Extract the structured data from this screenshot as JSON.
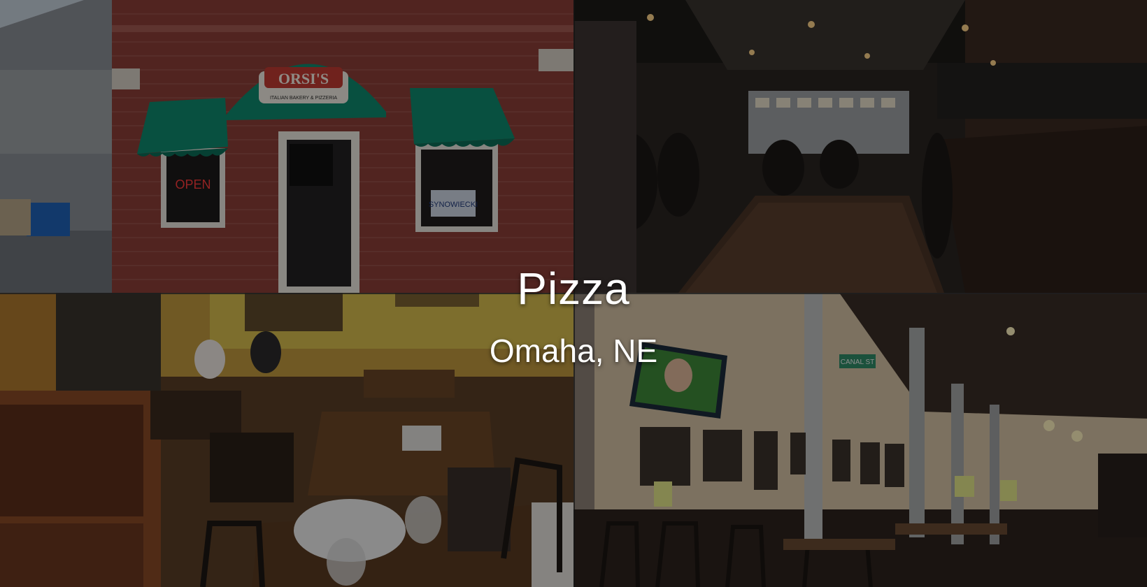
{
  "hero": {
    "title": "Pizza",
    "subtitle": "Omaha, NE"
  },
  "photos": [
    {
      "name": "storefront",
      "sign_text": "ORSI'S",
      "sign_subtext": "ITALIAN BAKERY & PIZZERIA",
      "window_sign": "OPEN",
      "poster_text": "SYNOWIECKI"
    },
    {
      "name": "bar-interior"
    },
    {
      "name": "dining-room-booths"
    },
    {
      "name": "dining-hall-tv",
      "street_sign": "CANAL ST"
    }
  ],
  "colors": {
    "awning": "#0f8a6e",
    "brick": "#8b3a33",
    "overlay": "#000000"
  }
}
